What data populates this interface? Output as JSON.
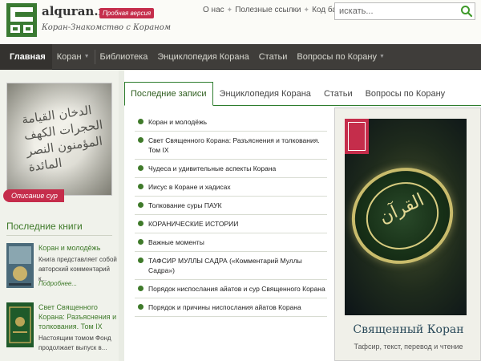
{
  "header": {
    "site_name": "alquran.ru",
    "beta_badge": "Пробная версия",
    "tagline": "Коран-Знакомство с Кораном",
    "top_links": [
      "О нас",
      "Полезные ссылки",
      "Код баннера"
    ],
    "search_placeholder": "искать..."
  },
  "nav": {
    "items": [
      {
        "label": "Главная",
        "active": true
      },
      {
        "label": "Коран"
      },
      {
        "label": "Библиотека"
      },
      {
        "label": "Энциклопедия Корана"
      },
      {
        "label": "Статьи"
      },
      {
        "label": "Вопросы по Корану"
      }
    ]
  },
  "left": {
    "surah_label": "Описание сур",
    "latest_books_title": "Последние книги",
    "books": [
      {
        "title": "Коран и молодёжь",
        "desc": "Книга представляет собой авторский комментарий к...",
        "more": "Подробнее..."
      },
      {
        "title": "Свет Священного Корана: Разъяснения и толкования. Том IX",
        "desc": "Настоящим томом Фонд продолжает выпуск в..."
      }
    ]
  },
  "main": {
    "tabs": [
      "Последние записи",
      "Энциклопедия Корана",
      "Статьи",
      "Вопросы по Корану"
    ],
    "posts": [
      "Коран и молодёжь",
      "Свет Священного Корана: Разъяснения и толкования. Том IX",
      "Чудеса и удивительные аспекты Корана",
      "Иисус в Коране и хадисах",
      "Толкование суры ПАУК",
      "КОРАНИЧЕСКИЕ ИСТОРИИ",
      "Важные моменты",
      "ТАФСИР МУЛЛЫ САДРА («Комментарий Муллы Садра»)",
      "Порядок ниспослания айатов и сур Священного Корана",
      "Порядок и причины ниспослания айатов Корана"
    ],
    "quran_panel": {
      "title": "Священный Коран",
      "subtitle": "Тафсир, текст, перевод и чтение"
    }
  },
  "colors": {
    "accent_green": "#3f7a2a",
    "badge_red": "#c52d4b",
    "nav_bg": "#3f3d3a"
  }
}
